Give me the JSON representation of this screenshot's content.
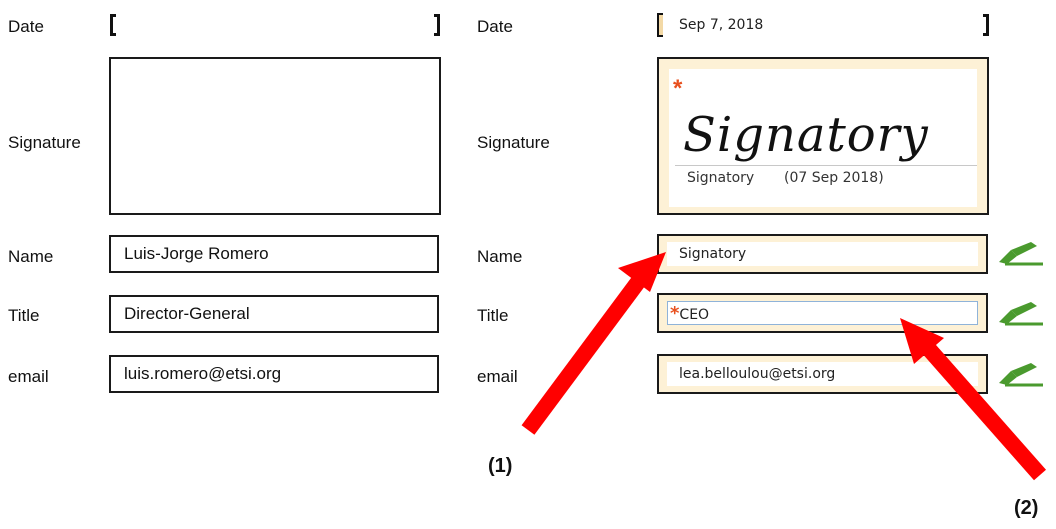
{
  "left": {
    "date_label": "Date",
    "signature_label": "Signature",
    "name_label": "Name",
    "name_value": "Luis-Jorge Romero",
    "title_label": "Title",
    "title_value": "Director-General",
    "email_label": "email",
    "email_value": "luis.romero@etsi.org"
  },
  "right": {
    "date_label": "Date",
    "date_value": "Sep 7, 2018",
    "signature_label": "Signature",
    "signature_required_mark": "*",
    "signature_script": "Signatory",
    "signature_caption": "Signatory",
    "signature_date": "(07 Sep 2018)",
    "name_label": "Name",
    "name_value": "Signatory",
    "title_label": "Title",
    "title_required_mark": "*",
    "title_value": "CEO",
    "email_label": "email",
    "email_value": "lea.belloulou@etsi.org"
  },
  "annotations": {
    "arrow1_label": "(1)",
    "arrow2_label": "(2)",
    "arrow_color": "#ff0000"
  },
  "icons": {
    "pen": "pen-hand-icon",
    "pen_color": "#4a9a2e"
  },
  "colors": {
    "field_bg": "#fdf1d6",
    "required": "#e8501e"
  }
}
